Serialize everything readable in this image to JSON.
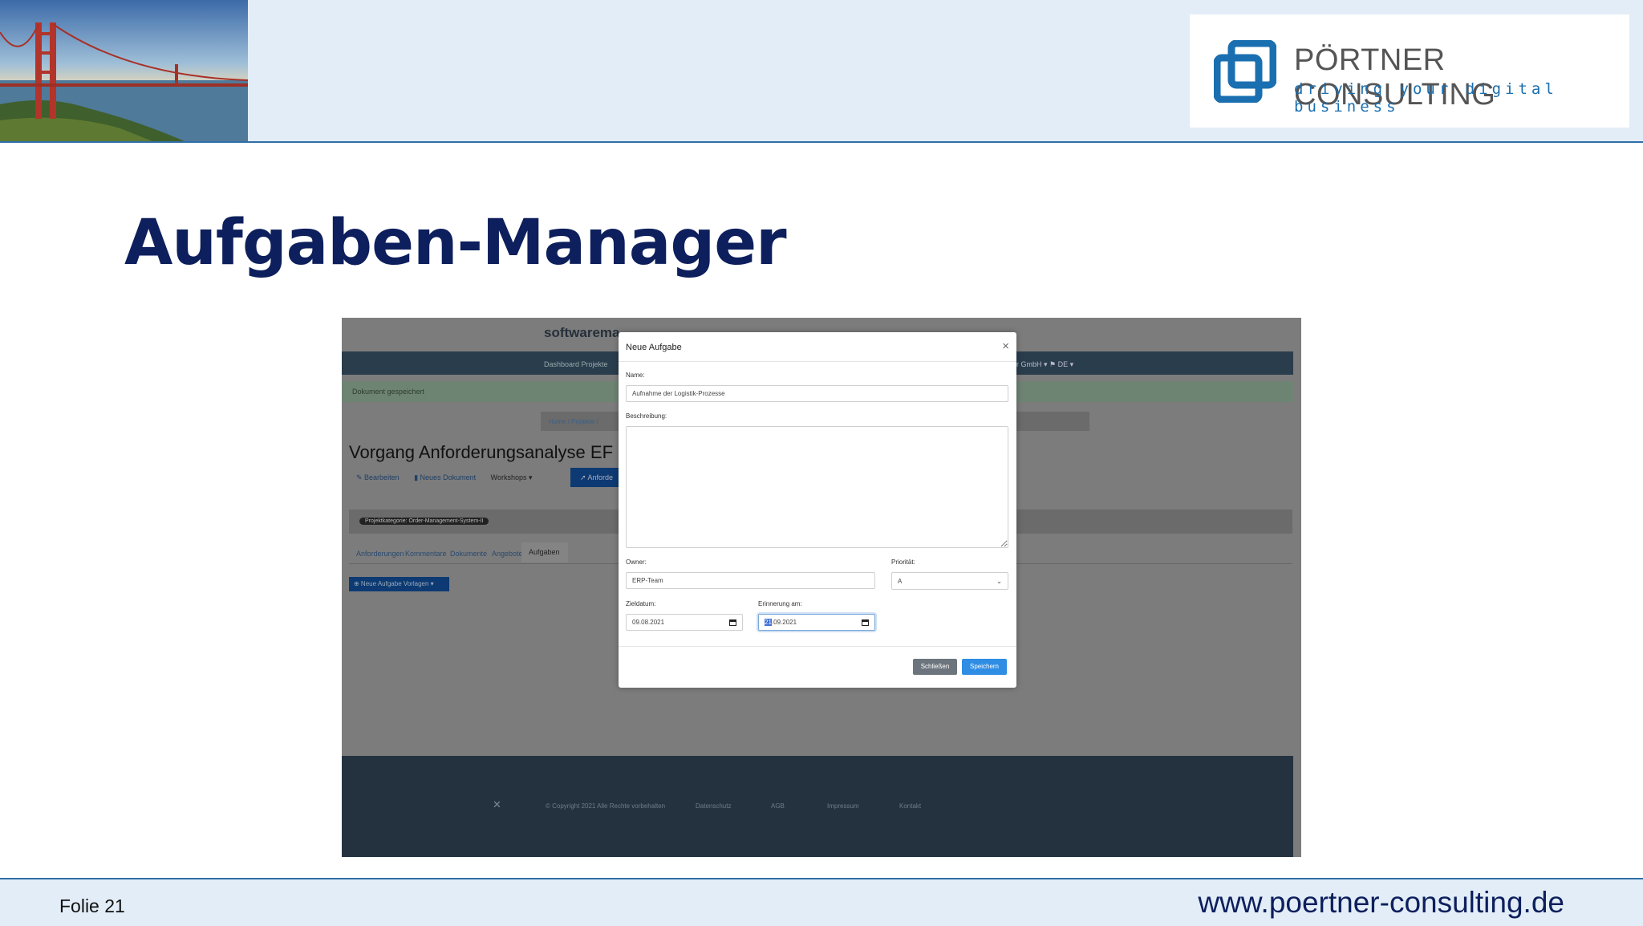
{
  "slide": {
    "title": "Aufgaben-Manager",
    "folie": "Folie 21",
    "website": "www.poertner-consulting.de",
    "logo_name": "PÖRTNER CONSULTING",
    "logo_tagline": "driving your digital business"
  },
  "app": {
    "brand": "softwarema",
    "nav_left": "Dashboard    Projekte",
    "nav_right": "er GmbH ▾     ⚑ DE ▾",
    "alert": "Dokument gespeichert",
    "breadcrumb": "Home  /  Projekte  /",
    "page_heading": "Vorgang Anforderungsanalyse EF",
    "actions": {
      "edit": "✎ Bearbeiten",
      "new_doc": "▮ Neues Dokument",
      "workshops": "Workshops ▾",
      "requirements_btn": "➚ Anforde"
    },
    "category_badge": "Projektkategorie: Order-Management-System-II",
    "subtabs": [
      "Anforderungen",
      "Kommentare",
      "Dokumente",
      "Angebote",
      "Aufgaben"
    ],
    "task_button": "⊕ Neue Aufgabe    Vorlagen ▾",
    "footer": {
      "copyright": "© Copyright 2021 Alle Rechte vorbehalten",
      "privacy": "Datenschutz",
      "terms": "AGB",
      "imprint": "Impressum",
      "contact": "Kontakt"
    }
  },
  "modal": {
    "title": "Neue Aufgabe",
    "close": "×",
    "name_label": "Name:",
    "name_value": "Aufnahme der Logistik-Prozesse",
    "description_label": "Beschreibung:",
    "description_value": "",
    "owner_label": "Owner:",
    "owner_value": "ERP-Team",
    "priority_label": "Priorität:",
    "priority_value": "A",
    "due_label": "Zieldatum:",
    "due_value": "09.08.2021",
    "reminder_label": "Erinnerung am:",
    "reminder_day": "21",
    "reminder_rest": ".09.2021",
    "close_btn": "Schließen",
    "save_btn": "Speichern"
  }
}
